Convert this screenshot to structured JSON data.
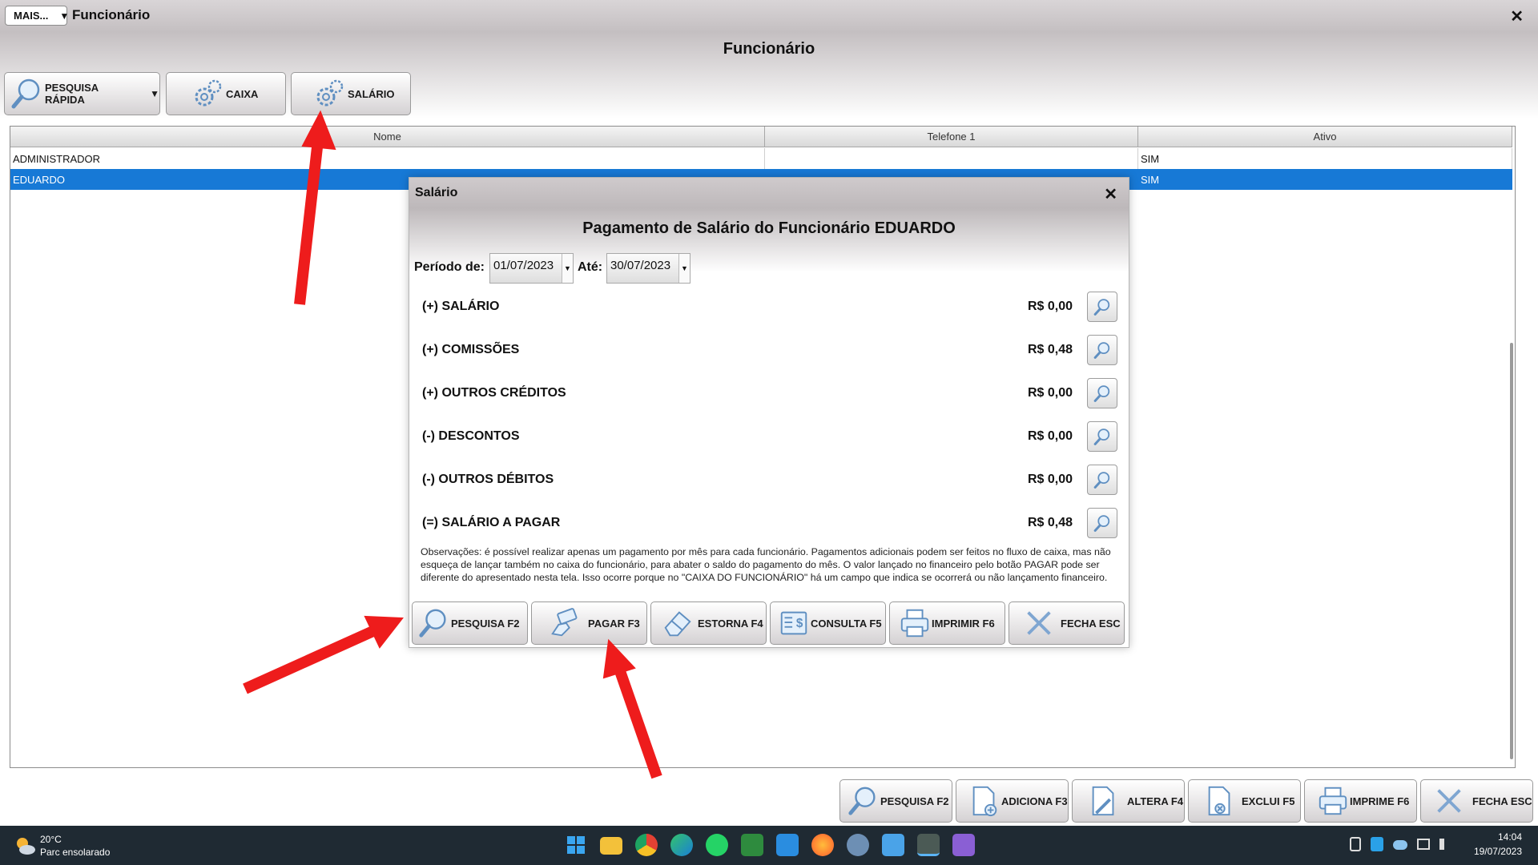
{
  "window": {
    "title": "Funcionário",
    "mais_label": "MAIS...",
    "mais_caret": "▼",
    "close_glyph": "✕"
  },
  "page_title": "Funcionário",
  "toolbar": {
    "quick_search": "PESQUISA RÁPIDA",
    "quick_search_caret": "▼",
    "caixa": "CAIXA",
    "salario": "SALÁRIO"
  },
  "grid": {
    "columns": [
      "Nome",
      "Telefone 1",
      "Ativo"
    ],
    "rows": [
      {
        "nome": "ADMINISTRADOR",
        "telefone": "",
        "ativo": "SIM",
        "selected": false
      },
      {
        "nome": "EDUARDO",
        "telefone": "",
        "ativo": "SIM",
        "selected": true
      }
    ]
  },
  "dialog": {
    "title": "Salário",
    "close_glyph": "✕",
    "heading": "Pagamento de Salário do Funcionário EDUARDO",
    "period_label": "Período de:",
    "period_from": "01/07/2023",
    "period_to_label": "Até:",
    "period_to": "30/07/2023",
    "rows": [
      {
        "label": "(+) SALÁRIO",
        "value": "R$ 0,00"
      },
      {
        "label": "(+) COMISSÕES",
        "value": "R$ 0,48"
      },
      {
        "label": "(+) OUTROS CRÉDITOS",
        "value": "R$ 0,00"
      },
      {
        "label": "(-) DESCONTOS",
        "value": "R$ 0,00"
      },
      {
        "label": "(-) OUTROS DÉBITOS",
        "value": "R$ 0,00"
      },
      {
        "label": "(=) SALÁRIO A PAGAR",
        "value": "R$ 0,48"
      }
    ],
    "observations": "Observações: é possível realizar apenas um pagamento por mês para cada funcionário. Pagamentos adicionais podem ser feitos no fluxo de caixa, mas não esqueça de lançar também no caixa do funcionário, para abater o saldo do pagamento do mês. O valor lançado no financeiro pelo botão PAGAR pode ser diferente do apresentado nesta tela. Isso ocorre porque no \"CAIXA DO FUNCIONÁRIO\" há um campo que indica se ocorrerá ou não lançamento financeiro.",
    "buttons": {
      "pesquisa": "PESQUISA F2",
      "pagar": "PAGAR F3",
      "estorna": "ESTORNA F4",
      "consulta": "CONSULTA F5",
      "imprimir": "IMPRIMIR F6",
      "fecha": "FECHA ESC"
    }
  },
  "bottom_toolbar": {
    "pesquisa": "PESQUISA F2",
    "adiciona": "ADICIONA F3",
    "altera": "ALTERA F4",
    "exclui": "EXCLUI F5",
    "imprime": "IMPRIME F6",
    "fecha": "FECHA ESC"
  },
  "taskbar": {
    "weather_temp": "20°C",
    "weather_desc": "Parc ensolarado",
    "time": "14:04",
    "date": "19/07/2023",
    "apps": [
      "windows-start",
      "file-explorer",
      "chrome",
      "edge",
      "whatsapp",
      "spreadsheet",
      "mail",
      "firefox",
      "settings",
      "notepad",
      "erp-app",
      "video-editor"
    ]
  },
  "colors": {
    "selection": "#1779d6",
    "arrow": "#ee1c1c",
    "taskbar": "#1f2a33"
  }
}
